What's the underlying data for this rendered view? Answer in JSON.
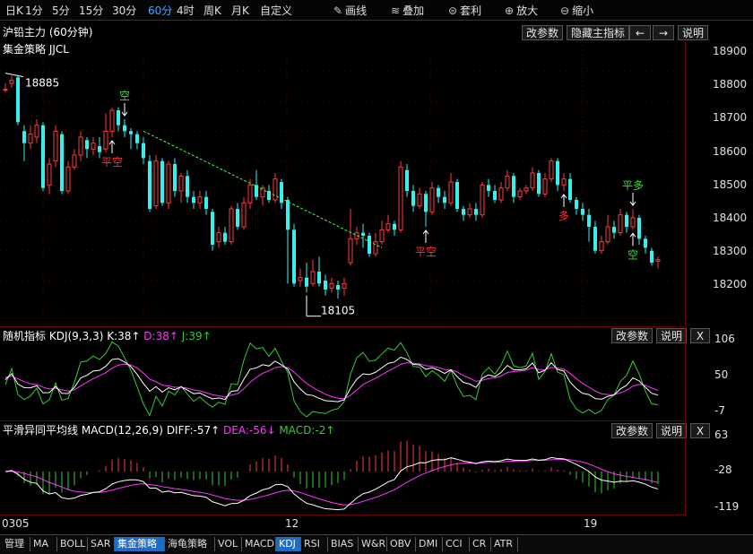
{
  "toolbar": {
    "items": [
      "日K",
      "1分",
      "5分",
      "15分",
      "30分",
      "60分",
      "4时",
      "周K",
      "月K",
      "自定义"
    ],
    "active_index": 5,
    "tools": [
      {
        "icon": "pencil-icon",
        "glyph": "✎",
        "label": "画线"
      },
      {
        "icon": "layers-icon",
        "glyph": "≋",
        "label": "叠加"
      },
      {
        "icon": "arbitrage-icon",
        "glyph": "⊜",
        "label": "套利"
      },
      {
        "icon": "zoom-in-icon",
        "glyph": "⊕",
        "label": "放大"
      },
      {
        "icon": "zoom-out-icon",
        "glyph": "⊖",
        "label": "缩小"
      }
    ]
  },
  "main": {
    "title": "沪铅主力 (60分钟)",
    "strategy": "集金策略 JJCL",
    "buttons": {
      "params": "改参数",
      "hide": "隐藏主指标",
      "left": "←",
      "right": "→",
      "help": "说明"
    },
    "yaxis": {
      "labels": [
        "18900",
        "18800",
        "18700",
        "18600",
        "18500",
        "18400",
        "18300",
        "18200"
      ],
      "min": 18080,
      "max": 18920
    },
    "high_label": "18885",
    "low_label": "18105",
    "signals": [
      {
        "text": "空",
        "color": "#3ddc3d"
      },
      {
        "text": "平空",
        "color": "#ff3030"
      },
      {
        "text": "平空",
        "color": "#ff3030"
      },
      {
        "text": "多",
        "color": "#ff3030"
      },
      {
        "text": "平多",
        "color": "#3ddc3d"
      },
      {
        "text": "空",
        "color": "#3ddc3d"
      }
    ]
  },
  "kdj": {
    "name": "随机指标",
    "params": "KDJ(9,3,3)",
    "k": "K:38↑",
    "d": "D:38↑",
    "j": "J:39↑",
    "buttons": {
      "params": "改参数",
      "help": "说明",
      "close": "X"
    },
    "yaxis": [
      "106",
      "50",
      "-7"
    ]
  },
  "macd": {
    "name": "平滑异同平均线",
    "params": "MACD(12,26,9)",
    "diff": "DIFF:-57↑",
    "dea": "DEA:-56↓",
    "macd": "MACD:-2↑",
    "buttons": {
      "params": "改参数",
      "help": "说明",
      "close": "X"
    },
    "yaxis": [
      "63",
      "-28",
      "-119"
    ]
  },
  "xaxis": [
    "0305",
    "12",
    "19"
  ],
  "bottom_tabs": [
    "管理",
    "MA",
    "BOLL",
    "SAR",
    "集金策略",
    "海龟策略",
    "VOL",
    "MACD",
    "KDJ",
    "RSI",
    "BIAS",
    "W&R",
    "OBV",
    "DMI",
    "CCI",
    "CR",
    "ATR"
  ],
  "bottom_selected": [
    4,
    8
  ],
  "colors": {
    "up": "#ff3b3b",
    "down": "#36f0f0",
    "k": "#ffffff",
    "d": "#ff33ff",
    "j": "#33cc33",
    "grid": "#6a0000",
    "trend": "#44ff44"
  },
  "chart_data": {
    "type": "candlestick",
    "title": "沪铅主力 (60分钟)",
    "ylim": [
      18080,
      18920
    ],
    "candles": [
      [
        18840,
        18840,
        18860,
        18830
      ],
      [
        18860,
        18870,
        18885,
        18845
      ],
      [
        18880,
        18730,
        18885,
        18720
      ],
      [
        18700,
        18660,
        18720,
        18600
      ],
      [
        18660,
        18690,
        18720,
        18640
      ],
      [
        18680,
        18720,
        18740,
        18660
      ],
      [
        18720,
        18510,
        18730,
        18500
      ],
      [
        18520,
        18590,
        18610,
        18490
      ],
      [
        18600,
        18700,
        18720,
        18580
      ],
      [
        18690,
        18500,
        18700,
        18490
      ],
      [
        18500,
        18580,
        18600,
        18490
      ],
      [
        18580,
        18620,
        18640,
        18570
      ],
      [
        18620,
        18680,
        18700,
        18600
      ],
      [
        18670,
        18640,
        18680,
        18610
      ],
      [
        18640,
        18660,
        18680,
        18620
      ],
      [
        18650,
        18630,
        18680,
        18610
      ],
      [
        18640,
        18700,
        18760,
        18630
      ],
      [
        18700,
        18770,
        18780,
        18680
      ],
      [
        18770,
        18720,
        18780,
        18700
      ],
      [
        18720,
        18700,
        18740,
        18680
      ],
      [
        18700,
        18690,
        18710,
        18640
      ],
      [
        18690,
        18660,
        18700,
        18640
      ],
      [
        18660,
        18610,
        18680,
        18590
      ],
      [
        18600,
        18440,
        18620,
        18430
      ],
      [
        18450,
        18600,
        18620,
        18440
      ],
      [
        18600,
        18460,
        18610,
        18450
      ],
      [
        18460,
        18590,
        18600,
        18440
      ],
      [
        18590,
        18500,
        18610,
        18480
      ],
      [
        18500,
        18550,
        18560,
        18460
      ],
      [
        18550,
        18480,
        18570,
        18460
      ],
      [
        18480,
        18460,
        18500,
        18440
      ],
      [
        18460,
        18480,
        18500,
        18440
      ],
      [
        18480,
        18440,
        18500,
        18420
      ],
      [
        18430,
        18320,
        18440,
        18300
      ],
      [
        18330,
        18360,
        18380,
        18310
      ],
      [
        18360,
        18330,
        18380,
        18320
      ],
      [
        18330,
        18440,
        18450,
        18320
      ],
      [
        18440,
        18380,
        18460,
        18370
      ],
      [
        18380,
        18460,
        18480,
        18370
      ],
      [
        18460,
        18520,
        18540,
        18440
      ],
      [
        18520,
        18480,
        18570,
        18470
      ],
      [
        18480,
        18510,
        18520,
        18450
      ],
      [
        18500,
        18470,
        18520,
        18460
      ],
      [
        18470,
        18540,
        18560,
        18460
      ],
      [
        18530,
        18460,
        18540,
        18440
      ],
      [
        18470,
        18370,
        18480,
        18190
      ],
      [
        18370,
        18190,
        18390,
        18180
      ],
      [
        18200,
        18210,
        18240,
        18180
      ],
      [
        18210,
        18180,
        18260,
        18160
      ],
      [
        18190,
        18230,
        18270,
        18180
      ],
      [
        18230,
        18190,
        18280,
        18180
      ],
      [
        18200,
        18170,
        18220,
        18150
      ],
      [
        18175,
        18190,
        18210,
        18160
      ],
      [
        18185,
        18170,
        18200,
        18140
      ],
      [
        18175,
        18190,
        18210,
        18150
      ],
      [
        18260,
        18340,
        18440,
        18250
      ],
      [
        18340,
        18360,
        18380,
        18320
      ],
      [
        18360,
        18350,
        18390,
        18310
      ],
      [
        18350,
        18290,
        18360,
        18280
      ],
      [
        18290,
        18330,
        18360,
        18280
      ],
      [
        18330,
        18370,
        18400,
        18320
      ],
      [
        18370,
        18390,
        18420,
        18360
      ],
      [
        18390,
        18370,
        18400,
        18350
      ],
      [
        18370,
        18580,
        18600,
        18360
      ],
      [
        18570,
        18500,
        18590,
        18480
      ],
      [
        18500,
        18450,
        18520,
        18430
      ],
      [
        18450,
        18490,
        18510,
        18440
      ],
      [
        18490,
        18430,
        18500,
        18380
      ],
      [
        18430,
        18510,
        18530,
        18420
      ],
      [
        18510,
        18480,
        18520,
        18460
      ],
      [
        18480,
        18460,
        18500,
        18440
      ],
      [
        18460,
        18530,
        18560,
        18450
      ],
      [
        18530,
        18440,
        18540,
        18430
      ],
      [
        18440,
        18420,
        18450,
        18400
      ],
      [
        18420,
        18440,
        18460,
        18410
      ],
      [
        18440,
        18420,
        18460,
        18400
      ],
      [
        18420,
        18520,
        18530,
        18410
      ],
      [
        18520,
        18500,
        18540,
        18480
      ],
      [
        18500,
        18470,
        18520,
        18460
      ],
      [
        18470,
        18510,
        18530,
        18460
      ],
      [
        18510,
        18550,
        18570,
        18500
      ],
      [
        18550,
        18480,
        18560,
        18460
      ],
      [
        18480,
        18500,
        18510,
        18470
      ],
      [
        18500,
        18510,
        18520,
        18490
      ],
      [
        18510,
        18560,
        18580,
        18500
      ],
      [
        18560,
        18490,
        18570,
        18480
      ],
      [
        18490,
        18540,
        18560,
        18480
      ],
      [
        18540,
        18600,
        18610,
        18530
      ],
      [
        18600,
        18520,
        18610,
        18500
      ],
      [
        18520,
        18540,
        18560,
        18500
      ],
      [
        18540,
        18470,
        18560,
        18460
      ],
      [
        18470,
        18440,
        18480,
        18420
      ],
      [
        18440,
        18420,
        18460,
        18400
      ],
      [
        18420,
        18380,
        18440,
        18330
      ],
      [
        18380,
        18300,
        18400,
        18290
      ],
      [
        18300,
        18330,
        18350,
        18290
      ],
      [
        18330,
        18380,
        18420,
        18320
      ],
      [
        18380,
        18360,
        18400,
        18340
      ],
      [
        18360,
        18420,
        18440,
        18350
      ],
      [
        18420,
        18380,
        18430,
        18360
      ],
      [
        18380,
        18410,
        18440,
        18370
      ],
      [
        18410,
        18340,
        18420,
        18320
      ],
      [
        18340,
        18310,
        18350,
        18290
      ],
      [
        18300,
        18260,
        18310,
        18250
      ],
      [
        18265,
        18270,
        18280,
        18240
      ]
    ],
    "trendline": {
      "from": [
        18700,
        18700
      ],
      "to": [
        18310,
        18310
      ]
    }
  }
}
